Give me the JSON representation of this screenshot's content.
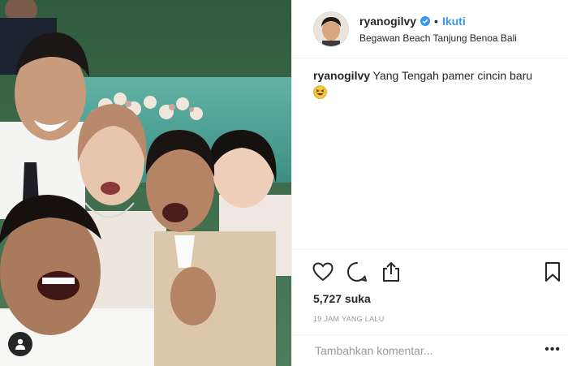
{
  "post": {
    "username": "ryanogilvy",
    "follow_label": "Ikuti",
    "separator": "•",
    "location": "Begawan Beach Tanjung Benoa Bali",
    "verified": true,
    "photo_icon": "person-tag-icon"
  },
  "caption": {
    "username": "ryanogilvy",
    "text": "Yang Tengah pamer cincin baru",
    "emoji": "grinning-squinting-face-emoji"
  },
  "actions": {
    "like_icon": "heart-icon",
    "comment_icon": "comment-icon",
    "share_icon": "share-icon",
    "save_icon": "bookmark-icon"
  },
  "likes": "5,727 suka",
  "timestamp": "19 JAM YANG LALU",
  "comment_box": {
    "placeholder": "Tambahkan komentar...",
    "more_label": "•••"
  },
  "colors": {
    "link_blue": "#3897f0",
    "text": "#262626",
    "muted": "#999999",
    "border": "#efefef"
  }
}
